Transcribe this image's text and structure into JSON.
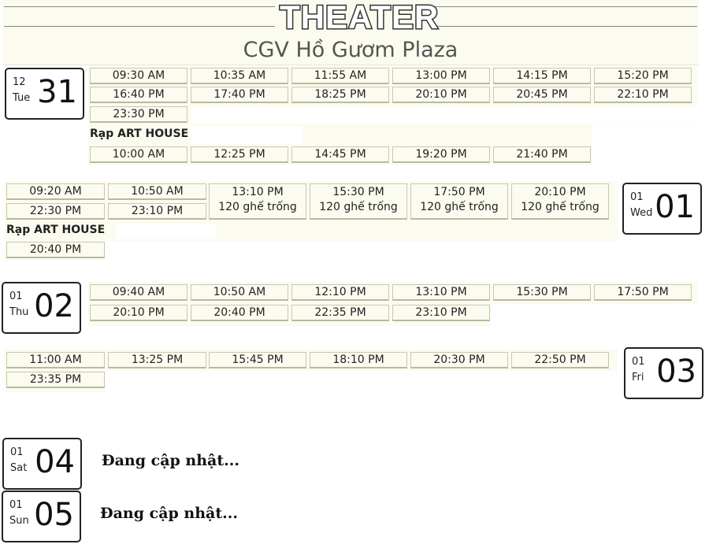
{
  "header": {
    "logo_text": "THEATER",
    "theater_name": "CGV Hồ Gươm Plaza"
  },
  "days": [
    {
      "month": "12",
      "weekday": "Tue",
      "day": "31",
      "standard": [
        "09:30 AM",
        "10:35 AM",
        "11:55 AM",
        "13:00 PM",
        "14:15 PM",
        "15:20 PM",
        "16:40 PM",
        "17:40 PM",
        "18:25 PM",
        "20:10 PM",
        "20:45 PM",
        "22:10 PM",
        "23:30 PM"
      ],
      "hall_label": "Rạp ART HOUSE",
      "hall": [
        "10:00 AM",
        "12:25 PM",
        "14:45 PM",
        "19:20 PM",
        "21:40 PM"
      ]
    },
    {
      "month": "01",
      "weekday": "Wed",
      "day": "01",
      "standard": [
        "09:20 AM",
        "10:50 AM",
        "13:10 PM",
        "15:30 PM",
        "17:50 PM",
        "20:10 PM",
        "22:30 PM",
        "23:10 PM"
      ],
      "seats_note": "120 ghế trống",
      "hall_label": "Rạp ART HOUSE",
      "hall": [
        "20:40 PM"
      ]
    },
    {
      "month": "01",
      "weekday": "Thu",
      "day": "02",
      "standard": [
        "09:40 AM",
        "10:50 AM",
        "12:10 PM",
        "13:10 PM",
        "15:30 PM",
        "17:50 PM",
        "20:10 PM",
        "20:40 PM",
        "22:35 PM",
        "23:10 PM"
      ]
    },
    {
      "month": "01",
      "weekday": "Fri",
      "day": "03",
      "standard": [
        "11:00 AM",
        "13:25 PM",
        "15:45 PM",
        "18:10 PM",
        "20:30 PM",
        "22:50 PM",
        "23:35 PM"
      ]
    },
    {
      "month": "01",
      "weekday": "Sat",
      "day": "04",
      "status": "Đang cập nhật..."
    },
    {
      "month": "01",
      "weekday": "Sun",
      "day": "05",
      "status": "Đang cập nhật..."
    }
  ]
}
